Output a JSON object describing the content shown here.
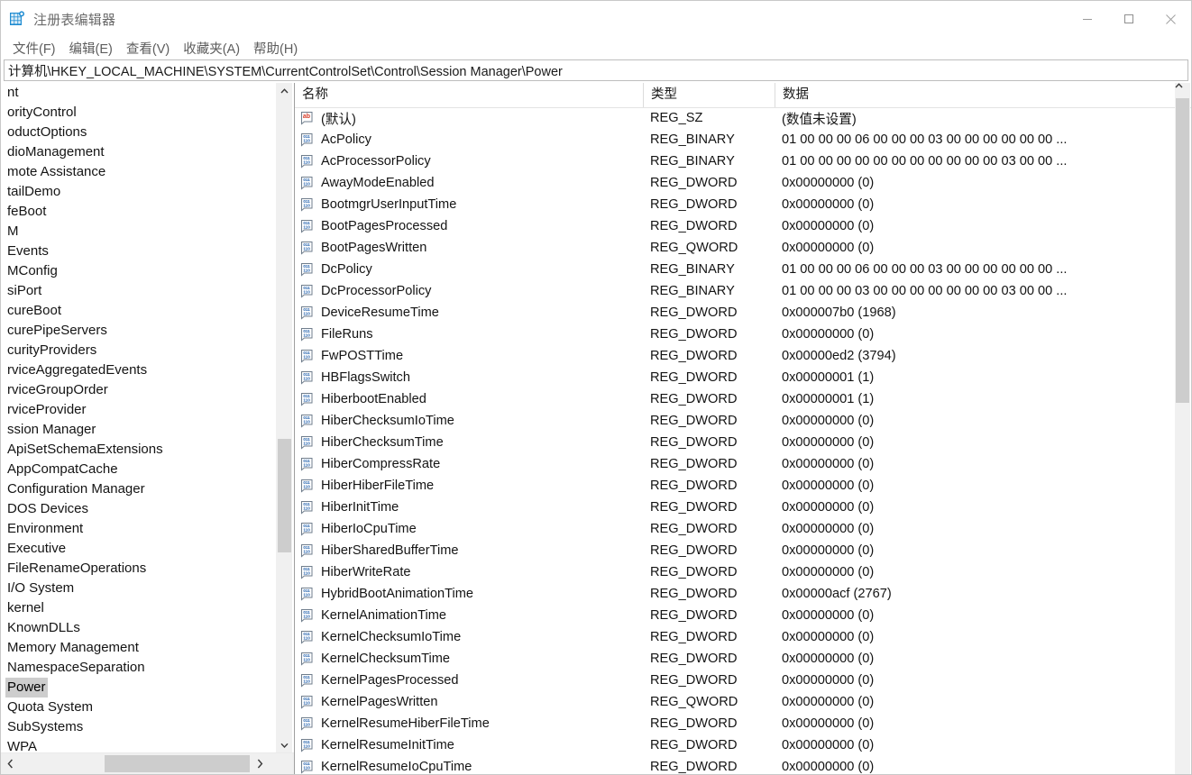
{
  "window": {
    "title": "注册表编辑器",
    "icon": "registry-editor-icon",
    "controls": {
      "minimize": "minimize-icon",
      "maximize": "maximize-icon",
      "close": "close-icon"
    }
  },
  "menu": {
    "items": [
      {
        "label": "文件(F)"
      },
      {
        "label": "编辑(E)"
      },
      {
        "label": "查看(V)"
      },
      {
        "label": "收藏夹(A)"
      },
      {
        "label": "帮助(H)"
      }
    ]
  },
  "address": {
    "path": "计算机\\HKEY_LOCAL_MACHINE\\SYSTEM\\CurrentControlSet\\Control\\Session Manager\\Power"
  },
  "tree": {
    "selected": "Power",
    "items": [
      {
        "label": "nt",
        "selected": false
      },
      {
        "label": "orityControl",
        "selected": false
      },
      {
        "label": "oductOptions",
        "selected": false
      },
      {
        "label": "dioManagement",
        "selected": false
      },
      {
        "label": "mote Assistance",
        "selected": false
      },
      {
        "label": "tailDemo",
        "selected": false
      },
      {
        "label": "feBoot",
        "selected": false
      },
      {
        "label": "M",
        "selected": false
      },
      {
        "label": "Events",
        "selected": false
      },
      {
        "label": "MConfig",
        "selected": false
      },
      {
        "label": "siPort",
        "selected": false
      },
      {
        "label": "cureBoot",
        "selected": false
      },
      {
        "label": "curePipeServers",
        "selected": false
      },
      {
        "label": "curityProviders",
        "selected": false
      },
      {
        "label": "rviceAggregatedEvents",
        "selected": false
      },
      {
        "label": "rviceGroupOrder",
        "selected": false
      },
      {
        "label": "rviceProvider",
        "selected": false
      },
      {
        "label": "ssion Manager",
        "selected": false
      },
      {
        "label": "ApiSetSchemaExtensions",
        "selected": false
      },
      {
        "label": "AppCompatCache",
        "selected": false
      },
      {
        "label": "Configuration Manager",
        "selected": false
      },
      {
        "label": "DOS Devices",
        "selected": false
      },
      {
        "label": "Environment",
        "selected": false
      },
      {
        "label": "Executive",
        "selected": false
      },
      {
        "label": "FileRenameOperations",
        "selected": false
      },
      {
        "label": "I/O System",
        "selected": false
      },
      {
        "label": "kernel",
        "selected": false
      },
      {
        "label": "KnownDLLs",
        "selected": false
      },
      {
        "label": "Memory Management",
        "selected": false
      },
      {
        "label": "NamespaceSeparation",
        "selected": false
      },
      {
        "label": "Power",
        "selected": true
      },
      {
        "label": "Quota System",
        "selected": false
      },
      {
        "label": "SubSystems",
        "selected": false
      },
      {
        "label": "WPA",
        "selected": false
      }
    ]
  },
  "list": {
    "columns": [
      {
        "label": "名称"
      },
      {
        "label": "类型"
      },
      {
        "label": "数据"
      }
    ],
    "rows": [
      {
        "icon": "string-value-icon",
        "name": "(默认)",
        "type": "REG_SZ",
        "data": "(数值未设置)"
      },
      {
        "icon": "binary-value-icon",
        "name": "AcPolicy",
        "type": "REG_BINARY",
        "data": "01 00 00 00 06 00 00 00 03 00 00 00 00 00 00 ..."
      },
      {
        "icon": "binary-value-icon",
        "name": "AcProcessorPolicy",
        "type": "REG_BINARY",
        "data": "01 00 00 00 00 00 00 00 00 00 00 00 03 00 00 ..."
      },
      {
        "icon": "binary-value-icon",
        "name": "AwayModeEnabled",
        "type": "REG_DWORD",
        "data": "0x00000000 (0)"
      },
      {
        "icon": "binary-value-icon",
        "name": "BootmgrUserInputTime",
        "type": "REG_DWORD",
        "data": "0x00000000 (0)"
      },
      {
        "icon": "binary-value-icon",
        "name": "BootPagesProcessed",
        "type": "REG_DWORD",
        "data": "0x00000000 (0)"
      },
      {
        "icon": "binary-value-icon",
        "name": "BootPagesWritten",
        "type": "REG_QWORD",
        "data": "0x00000000 (0)"
      },
      {
        "icon": "binary-value-icon",
        "name": "DcPolicy",
        "type": "REG_BINARY",
        "data": "01 00 00 00 06 00 00 00 03 00 00 00 00 00 00 ..."
      },
      {
        "icon": "binary-value-icon",
        "name": "DcProcessorPolicy",
        "type": "REG_BINARY",
        "data": "01 00 00 00 03 00 00 00 00 00 00 00 03 00 00 ..."
      },
      {
        "icon": "binary-value-icon",
        "name": "DeviceResumeTime",
        "type": "REG_DWORD",
        "data": "0x000007b0 (1968)"
      },
      {
        "icon": "binary-value-icon",
        "name": "FileRuns",
        "type": "REG_DWORD",
        "data": "0x00000000 (0)"
      },
      {
        "icon": "binary-value-icon",
        "name": "FwPOSTTime",
        "type": "REG_DWORD",
        "data": "0x00000ed2 (3794)"
      },
      {
        "icon": "binary-value-icon",
        "name": "HBFlagsSwitch",
        "type": "REG_DWORD",
        "data": "0x00000001 (1)"
      },
      {
        "icon": "binary-value-icon",
        "name": "HiberbootEnabled",
        "type": "REG_DWORD",
        "data": "0x00000001 (1)"
      },
      {
        "icon": "binary-value-icon",
        "name": "HiberChecksumIoTime",
        "type": "REG_DWORD",
        "data": "0x00000000 (0)"
      },
      {
        "icon": "binary-value-icon",
        "name": "HiberChecksumTime",
        "type": "REG_DWORD",
        "data": "0x00000000 (0)"
      },
      {
        "icon": "binary-value-icon",
        "name": "HiberCompressRate",
        "type": "REG_DWORD",
        "data": "0x00000000 (0)"
      },
      {
        "icon": "binary-value-icon",
        "name": "HiberHiberFileTime",
        "type": "REG_DWORD",
        "data": "0x00000000 (0)"
      },
      {
        "icon": "binary-value-icon",
        "name": "HiberInitTime",
        "type": "REG_DWORD",
        "data": "0x00000000 (0)"
      },
      {
        "icon": "binary-value-icon",
        "name": "HiberIoCpuTime",
        "type": "REG_DWORD",
        "data": "0x00000000 (0)"
      },
      {
        "icon": "binary-value-icon",
        "name": "HiberSharedBufferTime",
        "type": "REG_DWORD",
        "data": "0x00000000 (0)"
      },
      {
        "icon": "binary-value-icon",
        "name": "HiberWriteRate",
        "type": "REG_DWORD",
        "data": "0x00000000 (0)"
      },
      {
        "icon": "binary-value-icon",
        "name": "HybridBootAnimationTime",
        "type": "REG_DWORD",
        "data": "0x00000acf (2767)"
      },
      {
        "icon": "binary-value-icon",
        "name": "KernelAnimationTime",
        "type": "REG_DWORD",
        "data": "0x00000000 (0)"
      },
      {
        "icon": "binary-value-icon",
        "name": "KernelChecksumIoTime",
        "type": "REG_DWORD",
        "data": "0x00000000 (0)"
      },
      {
        "icon": "binary-value-icon",
        "name": "KernelChecksumTime",
        "type": "REG_DWORD",
        "data": "0x00000000 (0)"
      },
      {
        "icon": "binary-value-icon",
        "name": "KernelPagesProcessed",
        "type": "REG_DWORD",
        "data": "0x00000000 (0)"
      },
      {
        "icon": "binary-value-icon",
        "name": "KernelPagesWritten",
        "type": "REG_QWORD",
        "data": "0x00000000 (0)"
      },
      {
        "icon": "binary-value-icon",
        "name": "KernelResumeHiberFileTime",
        "type": "REG_DWORD",
        "data": "0x00000000 (0)"
      },
      {
        "icon": "binary-value-icon",
        "name": "KernelResumeInitTime",
        "type": "REG_DWORD",
        "data": "0x00000000 (0)"
      },
      {
        "icon": "binary-value-icon",
        "name": "KernelResumeIoCpuTime",
        "type": "REG_DWORD",
        "data": "0x00000000 (0)"
      }
    ]
  },
  "colors": {
    "accent_blue": "#0b6fc4",
    "string_icon_red": "#d63b27",
    "selection_grey": "#cdcdcd",
    "scrollbar_thumb": "#cdcdcd",
    "scrollbar_track": "#f0f0f0"
  }
}
